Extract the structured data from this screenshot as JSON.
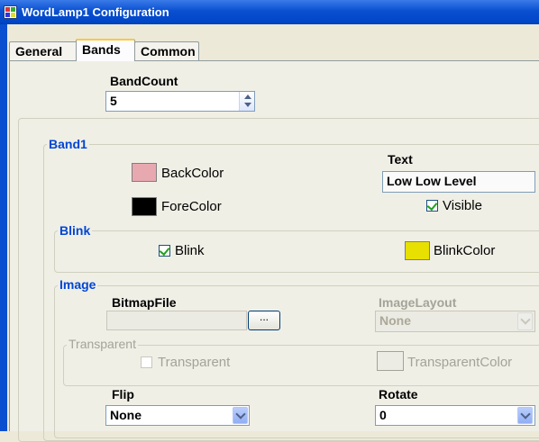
{
  "window": {
    "title": "WordLamp1 Configuration",
    "icon": "app-window-icon"
  },
  "tabs": [
    {
      "label": "General",
      "active": false
    },
    {
      "label": "Bands",
      "active": true
    },
    {
      "label": "Common",
      "active": false
    }
  ],
  "bandcount": {
    "label": "BandCount",
    "value": "5"
  },
  "band1": {
    "legend": "Band1",
    "backcolor": {
      "label": "BackColor",
      "color": "#e8a8b0"
    },
    "forecolor": {
      "label": "ForeColor",
      "color": "#000000"
    },
    "text": {
      "label": "Text",
      "value": "Low Low Level"
    },
    "visible": {
      "label": "Visible",
      "checked": true
    }
  },
  "blink": {
    "legend": "Blink",
    "blink_checkbox": {
      "label": "Blink",
      "checked": true
    },
    "blinkcolor": {
      "label": "BlinkColor",
      "color": "#e8e000"
    }
  },
  "image": {
    "legend": "Image",
    "bitmapfile": {
      "label": "BitmapFile",
      "value": "",
      "browse_label": "..."
    },
    "imagelayout": {
      "label": "ImageLayout",
      "value": "None"
    },
    "transparent_group": {
      "legend": "Transparent",
      "transparent": {
        "label": "Transparent",
        "checked": false
      },
      "transparentcolor": {
        "label": "TransparentColor",
        "color": "#ecebe4"
      }
    },
    "flip": {
      "label": "Flip",
      "value": "None"
    },
    "rotate": {
      "label": "Rotate",
      "value": "0"
    }
  }
}
